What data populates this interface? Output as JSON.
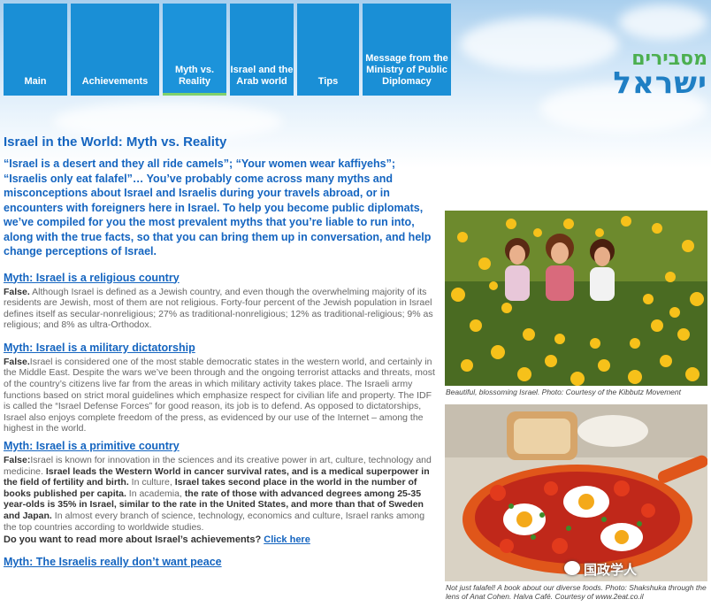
{
  "nav": {
    "items": [
      {
        "label": "Main"
      },
      {
        "label": "Achievements"
      },
      {
        "label": "Myth vs. Reality"
      },
      {
        "label": "Israel and the Arab world"
      },
      {
        "label": "Tips"
      },
      {
        "label": "Message from the Ministry of Public Diplomacy"
      }
    ]
  },
  "logo": {
    "top": "מסבירים",
    "bottom": "ישראל"
  },
  "page": {
    "title": "Israel in the World: Myth vs. Reality",
    "intro": "“Israel is a desert and they all ride camels”; “Your women wear kaffiyehs”; “Israelis only eat falafel”… You’ve probably come across many myths and misconceptions about Israel and Israelis during your travels abroad, or in encounters with foreigners here in Israel. To help you become public diplomats, we’ve compiled for you the most prevalent myths that you’re liable to run into, along with the true facts, so that you can bring them up in conversation, and help change perceptions of Israel."
  },
  "myths": [
    {
      "title": "Myth: Israel is a religious country",
      "lead": "False.",
      "body": " Although Israel is defined as a Jewish country, and even though the overwhelming majority of its residents are Jewish, most of them are not religious. Forty-four percent of the Jewish population in Israel defines itself as secular-nonreligious; 27% as traditional-nonreligious; 12% as traditional-religious; 9% as religious; and 8% as ultra-Orthodox."
    },
    {
      "title": "Myth: Israel is a military dictatorship",
      "lead": "False.",
      "body": "Israel is considered one of the most stable democratic states in the western world, and certainly in the Middle East. Despite the wars we’ve been through and the ongoing terrorist attacks and threats, most of the country’s citizens live far from the areas in which military activity takes place. The Israeli army functions based on strict moral guidelines which emphasize respect for civilian life and property. The IDF is called the “Israel Defense Forces” for good reason, its job is to defend. As opposed to dictatorships, Israel also enjoys complete freedom of the press, as evidenced by our use of the Internet – among the highest in the world."
    },
    {
      "title": "Myth: Israel is a primitive country",
      "lead": "False:",
      "p1": "Israel is known for innovation in the sciences and its creative power in art, culture, technology and medicine. ",
      "b1": "Israel leads the Western World in cancer survival rates, and is a medical superpower in the field of fertility and birth.",
      "p2": " In culture, ",
      "b2": "Israel takes second place in the world in the number of books published per capita.",
      "p3": " In academia, ",
      "b3": "the rate of those with advanced degrees among 25-35 year-olds is 35% in Israel, similar to the rate in the United States, and more than that of Sweden and Japan.",
      "p4": " In almost every branch of science, technology, economics and culture, Israel ranks among the top countries according to worldwide studies."
    },
    {
      "title": "Myth: The Israelis really don’t want peace"
    }
  ],
  "cta": {
    "question": "Do you want to read more about Israel’s achievements?",
    "link": "Click here"
  },
  "photos": {
    "top_caption": "Beautiful, blossoming Israel. Photo: Courtesy of the Kibbutz Movement",
    "bottom_caption": "Not just falafel! A book about our diverse foods. Photo: Shakshuka through the lens of Anat Cohen. Halva Café. Courtesy of www.2eat.co.il"
  },
  "watermark": "国政学人",
  "colors": {
    "nav": "#1a8fd6",
    "title": "#1565c0",
    "active_underline": "#7fd16b"
  }
}
